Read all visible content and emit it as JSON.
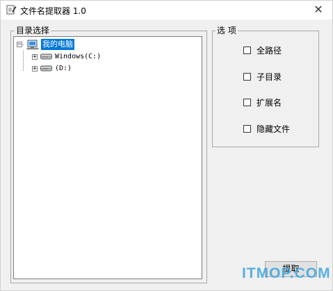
{
  "window": {
    "title": "文件名提取器 1.0",
    "close_symbol": "✕"
  },
  "directory": {
    "group_label": "目录选择",
    "tree": {
      "root_label": "我的电脑",
      "root_expander": "−",
      "drives": [
        {
          "label": "Windows(C:)",
          "expander": "+"
        },
        {
          "label": "(D:)",
          "expander": "+"
        }
      ]
    }
  },
  "options": {
    "group_label": "选 项",
    "items": [
      {
        "label": "全路径",
        "checked": false
      },
      {
        "label": "子目录",
        "checked": false
      },
      {
        "label": "扩展名",
        "checked": false
      },
      {
        "label": "隐藏文件",
        "checked": false
      }
    ]
  },
  "actions": {
    "extract_label": "提取"
  },
  "watermark": {
    "text": "ITMOP.COM"
  },
  "colors": {
    "selection": "#0078d7",
    "watermark": "#48a8e0",
    "window_bg": "#f0f0f0"
  },
  "icons": {
    "app": "notepad-pencil-icon",
    "close": "close-icon",
    "computer": "computer-icon",
    "drive": "hard-drive-icon"
  }
}
